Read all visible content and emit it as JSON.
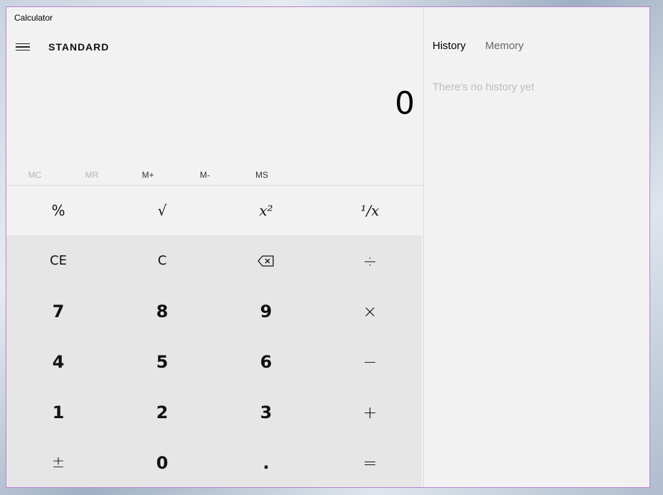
{
  "window": {
    "title": "Calculator",
    "controls": {
      "minimize": "minimize-icon",
      "maximize": "maximize-icon",
      "close": "close-icon"
    }
  },
  "header": {
    "mode": "STANDARD"
  },
  "display": {
    "value": "0"
  },
  "memory": {
    "buttons": [
      {
        "label": "MC",
        "enabled": false
      },
      {
        "label": "MR",
        "enabled": false
      },
      {
        "label": "M+",
        "enabled": true
      },
      {
        "label": "M-",
        "enabled": true
      },
      {
        "label": "MS",
        "enabled": true
      }
    ]
  },
  "keypad": {
    "row1": [
      "%",
      "√",
      "x²",
      "¹/x"
    ],
    "row2": [
      "CE",
      "C",
      "backspace-icon",
      "÷"
    ],
    "row3": [
      "7",
      "8",
      "9",
      "×"
    ],
    "row4": [
      "4",
      "5",
      "6",
      "−"
    ],
    "row5": [
      "1",
      "2",
      "3",
      "+"
    ],
    "row6": [
      "±",
      "0",
      ".",
      "="
    ]
  },
  "history_panel": {
    "tabs": [
      "History",
      "Memory"
    ],
    "active_tab": "History",
    "empty_message": "There's no history yet"
  },
  "colors": {
    "window_bg": "#f2f2f2",
    "keypad_bg": "#e6e6e6",
    "border_accent": "#b97fd0"
  }
}
